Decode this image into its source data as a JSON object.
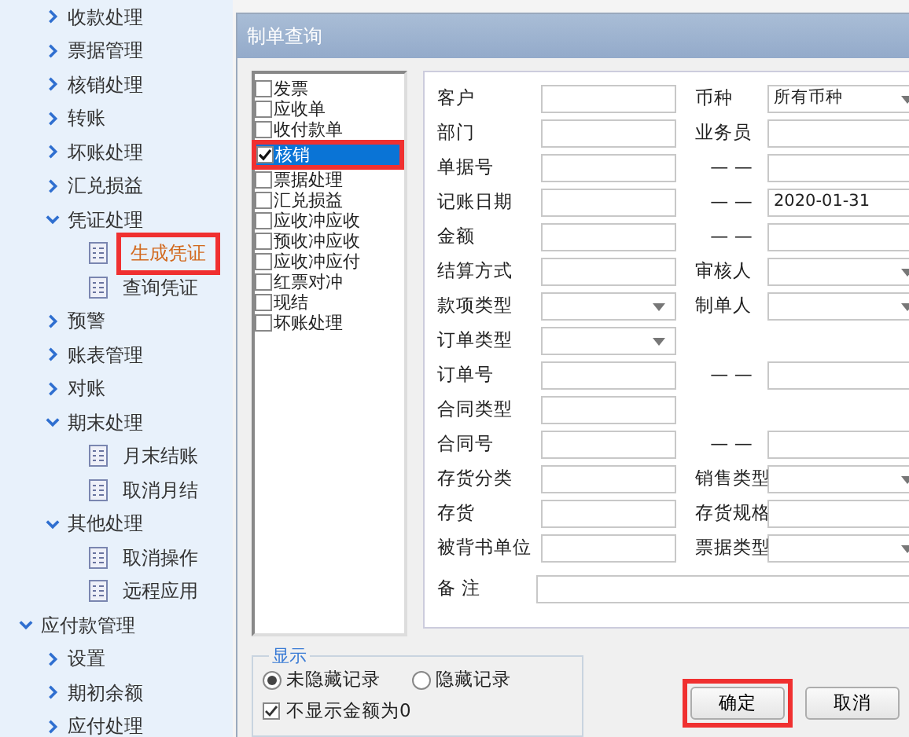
{
  "sidebar": {
    "items": [
      {
        "label": "收款处理",
        "expanded": false
      },
      {
        "label": "票据管理",
        "expanded": false
      },
      {
        "label": "核销处理",
        "expanded": false
      },
      {
        "label": "转账",
        "expanded": false
      },
      {
        "label": "坏账处理",
        "expanded": false
      },
      {
        "label": "汇兑损益",
        "expanded": false
      },
      {
        "label": "凭证处理",
        "expanded": true,
        "children": [
          {
            "label": "生成凭证",
            "selected": true,
            "highlighted": true
          },
          {
            "label": "查询凭证",
            "selected": false,
            "highlighted": false
          }
        ]
      },
      {
        "label": "预警",
        "expanded": false
      },
      {
        "label": "账表管理",
        "expanded": false
      },
      {
        "label": "对账",
        "expanded": false
      },
      {
        "label": "期末处理",
        "expanded": true,
        "children": [
          {
            "label": "月末结账",
            "selected": false,
            "highlighted": false
          },
          {
            "label": "取消月结",
            "selected": false,
            "highlighted": false
          }
        ]
      },
      {
        "label": "其他处理",
        "expanded": true,
        "children": [
          {
            "label": "取消操作",
            "selected": false,
            "highlighted": false
          },
          {
            "label": "远程应用",
            "selected": false,
            "highlighted": false
          }
        ]
      }
    ],
    "groups": [
      {
        "label": "应付款管理",
        "expanded": true,
        "children": [
          {
            "label": "设置",
            "expanded": false
          },
          {
            "label": "期初余额",
            "expanded": false
          },
          {
            "label": "应付处理",
            "expanded": false
          }
        ]
      }
    ]
  },
  "dialog": {
    "title": "制单查询",
    "types": [
      {
        "label": "发票",
        "checked": false,
        "selected": false,
        "highlighted": false
      },
      {
        "label": "应收单",
        "checked": false,
        "selected": false,
        "highlighted": false
      },
      {
        "label": "收付款单",
        "checked": false,
        "selected": false,
        "highlighted": false
      },
      {
        "label": "核销",
        "checked": true,
        "selected": true,
        "highlighted": true
      },
      {
        "label": "票据处理",
        "checked": false,
        "selected": false,
        "highlighted": false
      },
      {
        "label": "汇兑损益",
        "checked": false,
        "selected": false,
        "highlighted": false
      },
      {
        "label": "应收冲应收",
        "checked": false,
        "selected": false,
        "highlighted": false
      },
      {
        "label": "预收冲应收",
        "checked": false,
        "selected": false,
        "highlighted": false
      },
      {
        "label": "应收冲应付",
        "checked": false,
        "selected": false,
        "highlighted": false
      },
      {
        "label": "红票对冲",
        "checked": false,
        "selected": false,
        "highlighted": false
      },
      {
        "label": "现结",
        "checked": false,
        "selected": false,
        "highlighted": false
      },
      {
        "label": "坏账处理",
        "checked": false,
        "selected": false,
        "highlighted": false
      }
    ],
    "form": {
      "rows": [
        {
          "left": {
            "label": "客户",
            "kind": "text"
          },
          "right": {
            "label": "币种",
            "kind": "select",
            "value": "所有币种"
          }
        },
        {
          "left": {
            "label": "部门",
            "kind": "text"
          },
          "right": {
            "label": "业务员",
            "kind": "text"
          }
        },
        {
          "left": {
            "label": "单据号",
            "kind": "text"
          },
          "right": {
            "label": "— —",
            "kind": "text"
          }
        },
        {
          "left": {
            "label": "记账日期",
            "kind": "text"
          },
          "right": {
            "label": "— —",
            "kind": "text",
            "value": "2020-01-31"
          }
        },
        {
          "left": {
            "label": "金额",
            "kind": "text"
          },
          "right": {
            "label": "— —",
            "kind": "text"
          }
        },
        {
          "left": {
            "label": "结算方式",
            "kind": "text"
          },
          "right": {
            "label": "审核人",
            "kind": "select"
          }
        },
        {
          "left": {
            "label": "款项类型",
            "kind": "select"
          },
          "right": {
            "label": "制单人",
            "kind": "select"
          }
        },
        {
          "left": {
            "label": "订单类型",
            "kind": "select"
          }
        },
        {
          "left": {
            "label": "订单号",
            "kind": "text"
          },
          "right": {
            "label": "— —",
            "kind": "text"
          }
        },
        {
          "left": {
            "label": "合同类型",
            "kind": "text"
          }
        },
        {
          "left": {
            "label": "合同号",
            "kind": "text"
          },
          "right": {
            "label": "— —",
            "kind": "text"
          }
        },
        {
          "left": {
            "label": "存货分类",
            "kind": "text"
          },
          "right": {
            "label": "销售类型",
            "kind": "select"
          }
        },
        {
          "left": {
            "label": "存货",
            "kind": "text"
          },
          "right": {
            "label": "存货规格",
            "kind": "text"
          }
        },
        {
          "left": {
            "label": "被背书单位",
            "kind": "text"
          },
          "right": {
            "label": "票据类型",
            "kind": "select"
          }
        }
      ],
      "remark": {
        "label": "备 注"
      }
    },
    "display": {
      "legend": "显示",
      "options": [
        {
          "label": "未隐藏记录",
          "selected": true
        },
        {
          "label": "隐藏记录",
          "selected": false
        }
      ],
      "hide_zero": {
        "label": "不显示金额为0",
        "checked": true
      }
    },
    "buttons": [
      {
        "label": "确定",
        "highlighted": true
      },
      {
        "label": "取消",
        "highlighted": false
      }
    ]
  }
}
